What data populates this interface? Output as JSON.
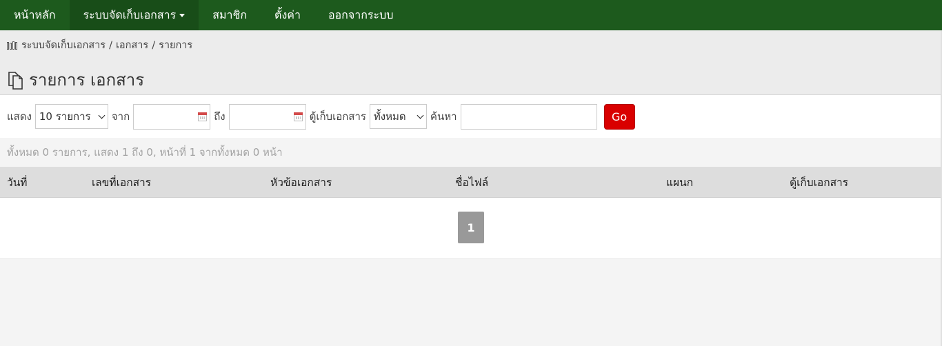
{
  "nav": {
    "items": [
      {
        "label": "หน้าหลัก"
      },
      {
        "label": "ระบบจัดเก็บเอกสาร"
      },
      {
        "label": "สมาชิก"
      },
      {
        "label": "ตั้งค่า"
      },
      {
        "label": "ออกจากระบบ"
      }
    ]
  },
  "breadcrumb": {
    "items": [
      "ระบบจัดเก็บเอกสาร",
      "เอกสาร",
      "รายการ"
    ],
    "separator": "/"
  },
  "page": {
    "title": "รายการ เอกสาร"
  },
  "filters": {
    "show_label": "แสดง",
    "show_value": "10 รายการ",
    "from_label": "จาก",
    "to_label": "ถึง",
    "cabinet_label": "ตู้เก็บเอกสาร",
    "cabinet_value": "ทั้งหมด",
    "search_label": "ค้นหา",
    "go_label": "Go"
  },
  "summary": "ทั้งหมด 0 รายการ, แสดง 1 ถึง 0, หน้าที่ 1 จากทั้งหมด 0 หน้า",
  "table": {
    "columns": [
      "วันที่",
      "เลขที่เอกสาร",
      "หัวข้อเอกสาร",
      "ชื่อไฟล์",
      "แผนก",
      "ตู้เก็บเอกสาร"
    ]
  },
  "pagination": {
    "current": "1"
  },
  "colors": {
    "nav_bg": "#1d5a1d",
    "go_button": "#d90000",
    "header_bg": "#ececec"
  }
}
